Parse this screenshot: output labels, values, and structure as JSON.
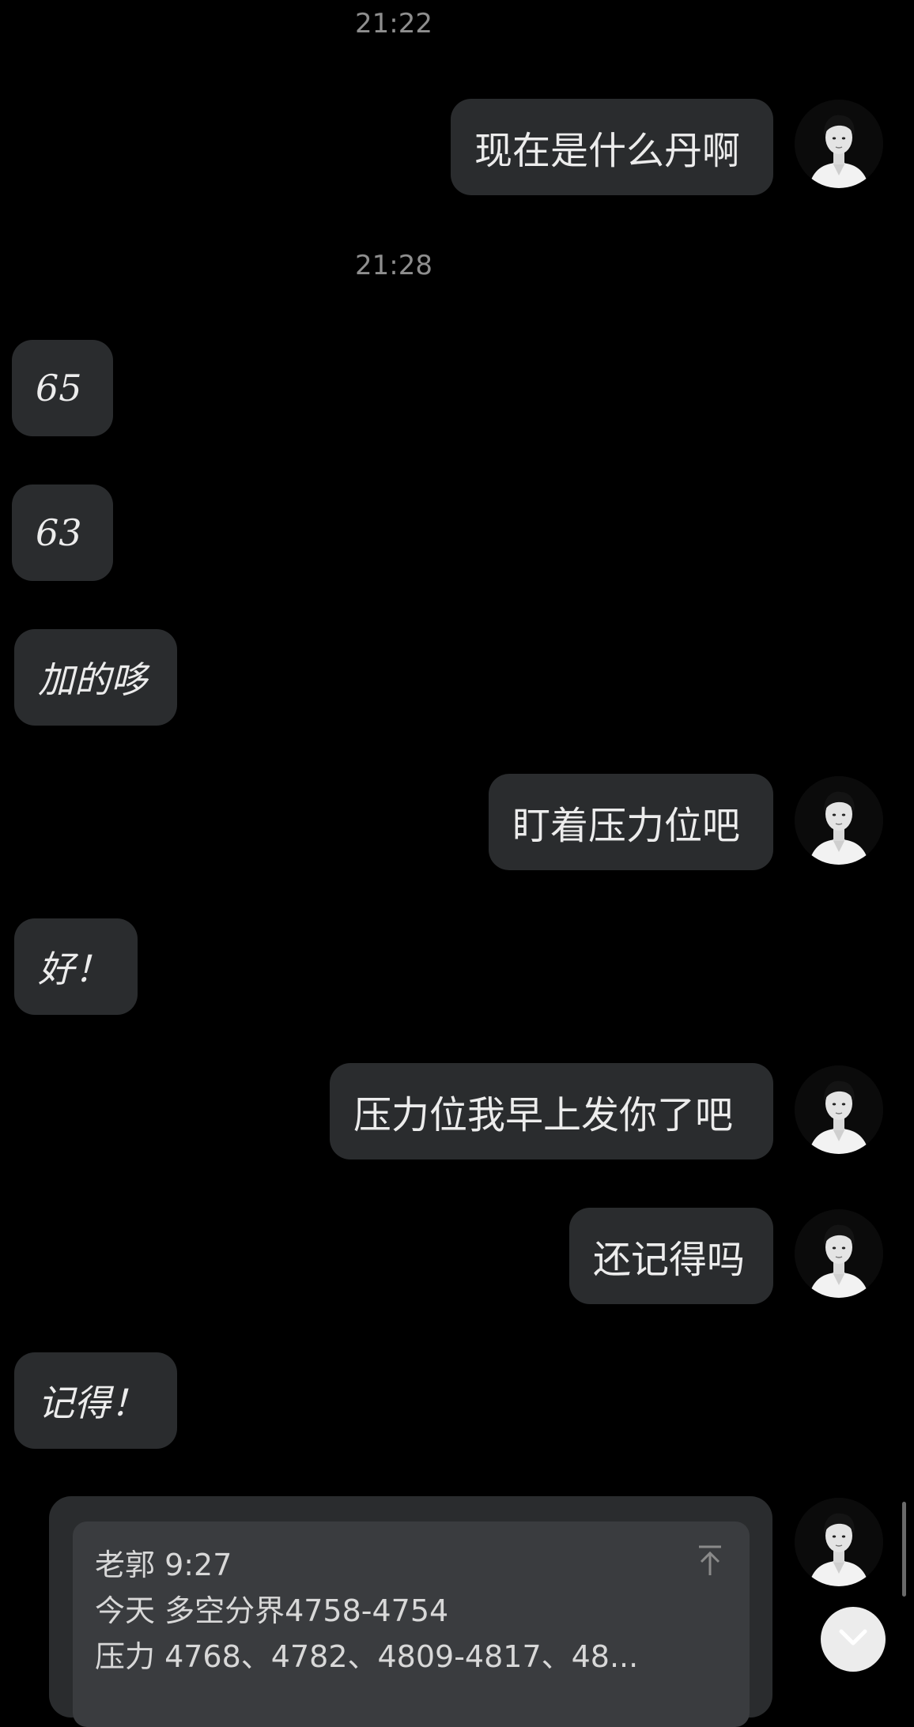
{
  "timestamps": [
    "21:22",
    "21:28"
  ],
  "messages": [
    {
      "dir": "out",
      "text": "现在是什么丹啊"
    },
    {
      "dir": "in",
      "text": "65"
    },
    {
      "dir": "in",
      "text": "63"
    },
    {
      "dir": "in",
      "text": "加的哆"
    },
    {
      "dir": "out",
      "text": "盯着压力位吧"
    },
    {
      "dir": "in",
      "text": "好！"
    },
    {
      "dir": "out",
      "text": "压力位我早上发你了吧"
    },
    {
      "dir": "out",
      "text": "还记得吗"
    },
    {
      "dir": "in",
      "text": "记得！"
    }
  ],
  "quote": {
    "author_time": "老郭 9:27",
    "line1": "今天 多空分界4758-4754",
    "line2": "压力 4768、4782、4809-4817、48..."
  },
  "icons": {
    "avatar": "user-avatar",
    "collapse": "collapse-up-icon",
    "scroll_down": "chevron-down-icon"
  },
  "colors": {
    "background": "#000000",
    "bubble": "#2a2c2e",
    "quote_inner": "#3a3c3f",
    "timestamp": "#8e8e8e"
  }
}
